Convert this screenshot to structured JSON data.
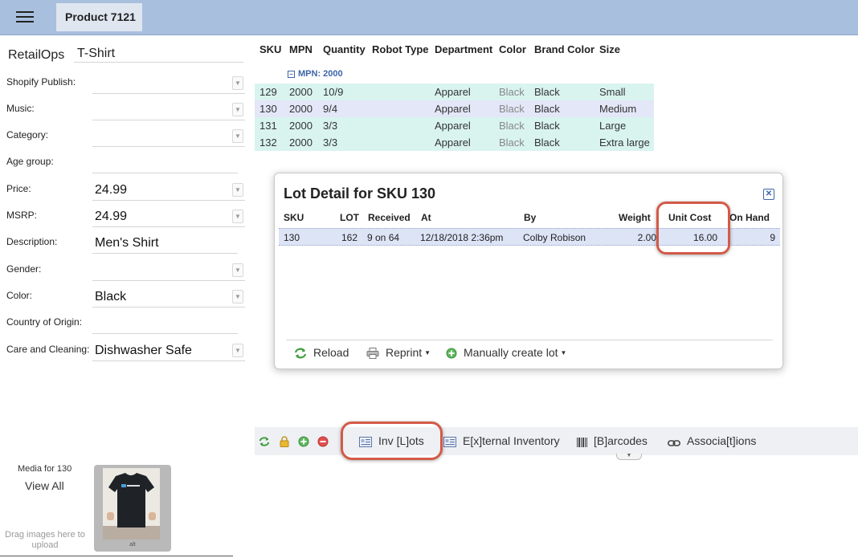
{
  "header": {
    "tab_label": "Product 7121"
  },
  "form": {
    "brand_label": "RetailOps",
    "product_name": "T-Shirt",
    "fields": [
      {
        "label": "Shopify Publish:",
        "value": ""
      },
      {
        "label": "Music:",
        "value": ""
      },
      {
        "label": "Category:",
        "value": ""
      },
      {
        "label": "Age group:",
        "value": ""
      },
      {
        "label": "Price:",
        "value": "24.99"
      },
      {
        "label": "MSRP:",
        "value": "24.99"
      },
      {
        "label": "Description:",
        "value": "Men's Shirt"
      },
      {
        "label": "Gender:",
        "value": ""
      },
      {
        "label": "Color:",
        "value": "Black"
      },
      {
        "label": "Country of Origin:",
        "value": ""
      },
      {
        "label": "Care and Cleaning:",
        "value": "Dishwasher Safe"
      }
    ]
  },
  "grid": {
    "columns": [
      "SKU",
      "MPN",
      "Quantity",
      "Robot Type",
      "Department",
      "Color",
      "Brand Color",
      "Size"
    ],
    "group_label": "MPN: 2000",
    "group_toggle": "−",
    "rows": [
      {
        "sku": "129",
        "mpn": "2000",
        "quantity": "10/9",
        "robot_type": "",
        "department": "Apparel",
        "color": "Black",
        "brand_color": "Black",
        "size": "Small"
      },
      {
        "sku": "130",
        "mpn": "2000",
        "quantity": "9/4",
        "robot_type": "",
        "department": "Apparel",
        "color": "Black",
        "brand_color": "Black",
        "size": "Medium"
      },
      {
        "sku": "131",
        "mpn": "2000",
        "quantity": "3/3",
        "robot_type": "",
        "department": "Apparel",
        "color": "Black",
        "brand_color": "Black",
        "size": "Large"
      },
      {
        "sku": "132",
        "mpn": "2000",
        "quantity": "3/3",
        "robot_type": "",
        "department": "Apparel",
        "color": "Black",
        "brand_color": "Black",
        "size": "Extra large"
      }
    ]
  },
  "lot_dialog": {
    "title": "Lot Detail for SKU 130",
    "close_glyph": "✕",
    "columns": [
      "SKU",
      "LOT",
      "Received",
      "At",
      "By",
      "Weight",
      "Unit Cost",
      "On Hand"
    ],
    "row": {
      "sku": "130",
      "lot": "162",
      "received": "9 on 64",
      "at": "12/18/2018 2:36pm",
      "by": "Colby Robison",
      "weight": "2.00",
      "unit_cost": "16.00",
      "on_hand": "9"
    },
    "toolbar": {
      "reload": "Reload",
      "reprint": "Reprint",
      "manual_create": "Manually create lot"
    }
  },
  "bottom_tabs": {
    "inv_lots": "Inv [L]ots",
    "external_inventory": "E[x]ternal Inventory",
    "barcodes": "[B]arcodes",
    "associations": "Associa[t]ions"
  },
  "media": {
    "title": "Media for 130",
    "view_all": "View All",
    "drop_hint": "Drag images here to upload",
    "thumb_caption": "alt"
  },
  "colors": {
    "topbar": "#a9bfde",
    "highlight": "#d35a47",
    "row_teal": "#d9f4ef",
    "row_blue": "#e3e7f7",
    "group_blue": "#3e64a8"
  }
}
